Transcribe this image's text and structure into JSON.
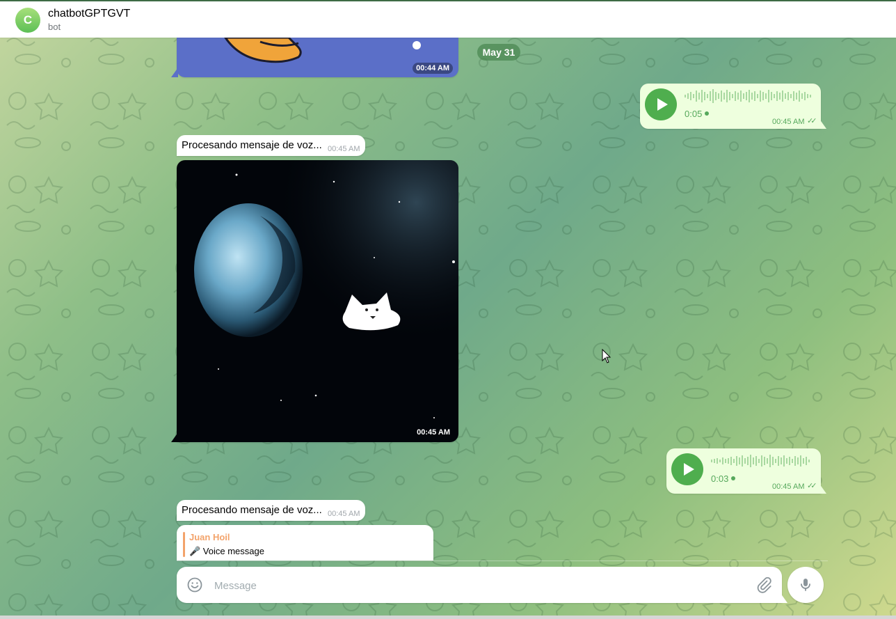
{
  "header": {
    "avatar_letter": "C",
    "title": "chatbotGPTGVT",
    "subtitle": "bot"
  },
  "date_separator": "May 31",
  "messages": [
    {
      "type": "sticker_image",
      "direction": "in",
      "time": "00:44 AM"
    },
    {
      "type": "voice",
      "direction": "out",
      "duration": "0:05",
      "time": "00:45 AM"
    },
    {
      "type": "text",
      "direction": "in",
      "text": "Procesando mensaje de voz...",
      "time": "00:45 AM"
    },
    {
      "type": "image",
      "direction": "in",
      "time": "00:45 AM"
    },
    {
      "type": "voice",
      "direction": "out",
      "duration": "0:03",
      "time": "00:45 AM"
    },
    {
      "type": "text",
      "direction": "in",
      "text": "Procesando mensaje de voz...",
      "time": "00:45 AM"
    },
    {
      "type": "reply",
      "direction": "in",
      "reply_author": "Juan Hoil",
      "reply_text": "🎤 Voice message"
    }
  ],
  "composer": {
    "placeholder": "Message",
    "emoji_icon": "emoji-icon",
    "attach_icon": "paperclip-icon",
    "mic_icon": "microphone-icon"
  },
  "colors": {
    "accent": "#4fae4e",
    "outgoing_bubble": "#eeffde",
    "reply_author": "#f3a36b",
    "date_chip": "#4a8750"
  }
}
